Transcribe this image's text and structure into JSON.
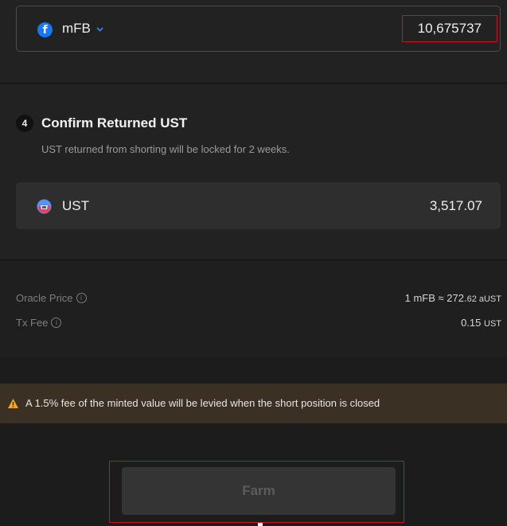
{
  "asset_input": {
    "symbol": "mFB",
    "icon": "facebook-icon",
    "amount": "10,675737"
  },
  "step4": {
    "number": "4",
    "title": "Confirm Returned UST",
    "description": "UST returned from shorting will be locked for 2 weeks.",
    "token": {
      "symbol": "UST",
      "icon": "ust-icon",
      "amount": "3,517.07"
    }
  },
  "details": {
    "oracle_price": {
      "label": "Oracle Price",
      "value": "1 mFB ≈ 272.",
      "value_small": "62 aUST"
    },
    "tx_fee": {
      "label": "Tx Fee",
      "value": "0.15",
      "unit": "UST"
    }
  },
  "warning": {
    "icon": "warning-icon",
    "text": "A 1.5% fee of the minted value will be levied when the short position is closed"
  },
  "submit": {
    "label": "Farm",
    "disabled": true
  },
  "colors": {
    "background": "#1c1c1c",
    "panel": "#222222",
    "highlight_border": "#c4161c",
    "warning_bg": "#3a3024",
    "warning_icon": "#f5a623",
    "facebook_blue": "#1877f2"
  }
}
